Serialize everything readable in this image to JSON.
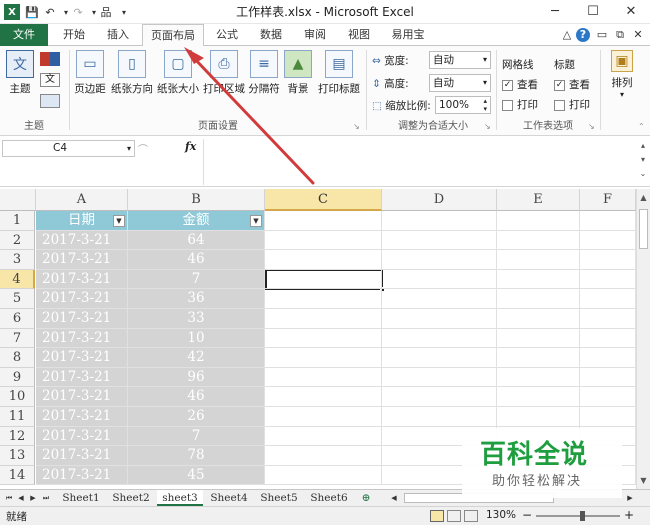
{
  "window": {
    "title": "工作样表.xlsx - Microsoft Excel",
    "controls": {
      "minimize": "─",
      "maximize": "☐",
      "close": "✕"
    }
  },
  "qat": {
    "save": "💾",
    "undo": "↶",
    "redo": "↷",
    "extra": "品",
    "menu": "▾"
  },
  "tabs": {
    "file": "文件",
    "items": [
      "开始",
      "插入",
      "页面布局",
      "公式",
      "数据",
      "审阅",
      "视图",
      "易用宝"
    ],
    "active_index": 2,
    "right_icons": {
      "collapse": "△",
      "help": "?",
      "restore": "▭",
      "min": "⧉",
      "close": "✕"
    }
  },
  "ribbon": {
    "groups": {
      "theme": {
        "label": "主题",
        "theme_btn": "主题"
      },
      "page_setup": {
        "label": "页面设置",
        "buttons": [
          "页边距",
          "纸张方向",
          "纸张大小",
          "打印区域",
          "分隔符",
          "背景",
          "打印标题"
        ]
      },
      "scale": {
        "label": "调整为合适大小",
        "width_label": "宽度:",
        "width_value": "自动",
        "height_label": "高度:",
        "height_value": "自动",
        "zoom_label": "缩放比例:",
        "zoom_value": "100%"
      },
      "sheet_options": {
        "label": "工作表选项",
        "gridlines": "网格线",
        "headings": "标题",
        "view": "查看",
        "print": "打印"
      },
      "arrange": {
        "label": "排列"
      }
    }
  },
  "formula_bar": {
    "name_box": "C4",
    "fx": "fx",
    "content": ""
  },
  "grid": {
    "columns": [
      "A",
      "B",
      "C",
      "D",
      "E",
      "F"
    ],
    "selected_column": "C",
    "selected_row": 4,
    "header_row": {
      "a": "日期",
      "b": "金额"
    },
    "rows": [
      {
        "num": "1"
      },
      {
        "num": "2",
        "a": "2017-3-21",
        "b": "64"
      },
      {
        "num": "3",
        "a": "2017-3-21",
        "b": "46"
      },
      {
        "num": "4",
        "a": "2017-3-21",
        "b": "7"
      },
      {
        "num": "5",
        "a": "2017-3-21",
        "b": "36"
      },
      {
        "num": "6",
        "a": "2017-3-21",
        "b": "33"
      },
      {
        "num": "7",
        "a": "2017-3-21",
        "b": "10"
      },
      {
        "num": "8",
        "a": "2017-3-21",
        "b": "42"
      },
      {
        "num": "9",
        "a": "2017-3-21",
        "b": "96"
      },
      {
        "num": "10",
        "a": "2017-3-21",
        "b": "46"
      },
      {
        "num": "11",
        "a": "2017-3-21",
        "b": "26"
      },
      {
        "num": "12",
        "a": "2017-3-21",
        "b": "7"
      },
      {
        "num": "13",
        "a": "2017-3-21",
        "b": "78"
      },
      {
        "num": "14",
        "a": "2017-3-21",
        "b": "45"
      }
    ]
  },
  "sheets": {
    "tabs": [
      "Sheet1",
      "Sheet2",
      "sheet3",
      "Sheet4",
      "Sheet5",
      "Sheet6"
    ],
    "active_index": 2,
    "nav": [
      "⏮",
      "◀",
      "▶",
      "⏭"
    ]
  },
  "status": {
    "ready": "就绪",
    "zoom": "130%",
    "zoom_minus": "−",
    "zoom_plus": "+"
  },
  "watermark": {
    "title": "百科全说",
    "subtitle": "助你轻松解决"
  },
  "colors": {
    "file_tab": "#217346",
    "header_fill": "#8fc9d8",
    "grey_fill": "#d4d4d4",
    "selection_header": "#f8e6a8",
    "arrow": "#d23b3b",
    "watermark_green": "#1e9e3f"
  }
}
